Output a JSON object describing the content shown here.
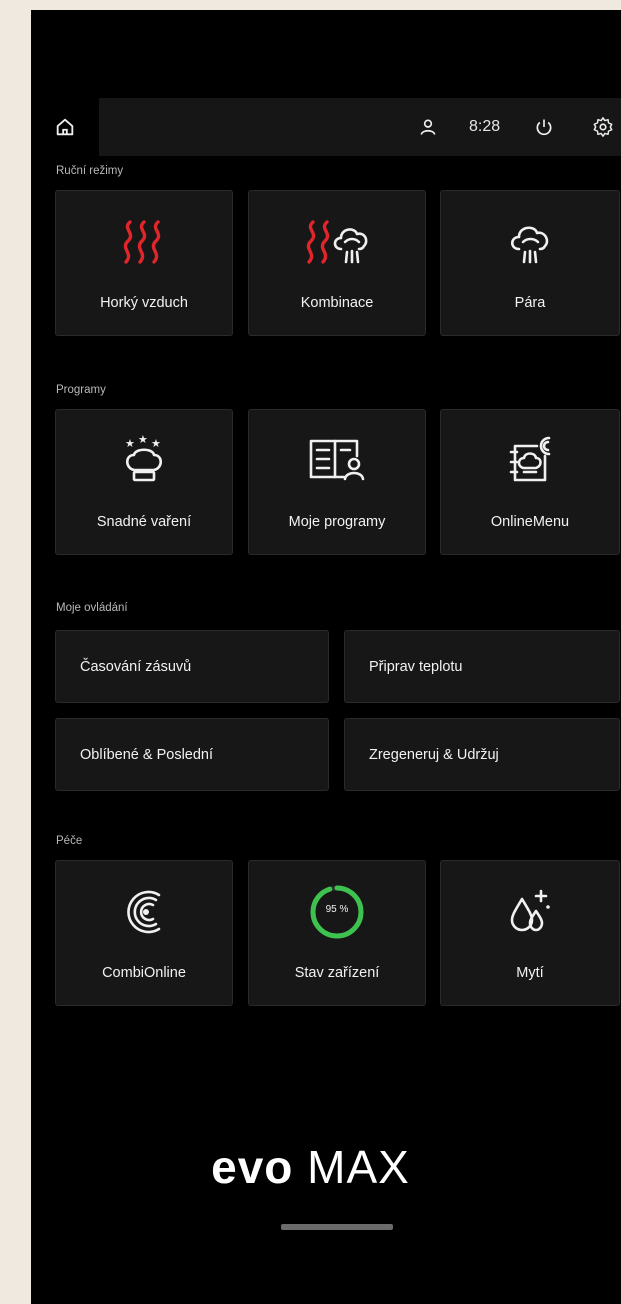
{
  "header": {
    "time": "8:28"
  },
  "sections": {
    "manual": {
      "title": "Ruční režimy",
      "items": [
        {
          "label": "Horký vzduch"
        },
        {
          "label": "Kombinace"
        },
        {
          "label": "Pára"
        }
      ]
    },
    "programs": {
      "title": "Programy",
      "items": [
        {
          "label": "Snadné vaření"
        },
        {
          "label": "Moje programy"
        },
        {
          "label": "OnlineMenu"
        }
      ]
    },
    "controls": {
      "title": "Moje ovládání",
      "items": [
        {
          "label": "Časování zásuvů"
        },
        {
          "label": "Připrav teplotu"
        },
        {
          "label": "Oblíbené & Poslední"
        },
        {
          "label": "Zregeneruj  & Udržuj"
        }
      ]
    },
    "care": {
      "title": "Péče",
      "items": [
        {
          "label": "CombiOnline"
        },
        {
          "label": "Stav zařízení"
        },
        {
          "label": "Mytí"
        }
      ],
      "status_percent": "95 %",
      "status_value": 95
    }
  },
  "brand": {
    "part1": "evo",
    "part2": " MAX"
  },
  "colors": {
    "heat": "#e0262b",
    "progress": "#3ec24f",
    "background": "#000000",
    "tile": "#171717"
  },
  "icons": [
    "home-icon",
    "user-icon",
    "power-icon",
    "gear-icon",
    "heat-waves-icon",
    "steam-cloud-icon",
    "chef-hat-icon",
    "recipe-book-icon",
    "online-menu-icon",
    "combionline-icon",
    "mytí-drops-icon"
  ]
}
